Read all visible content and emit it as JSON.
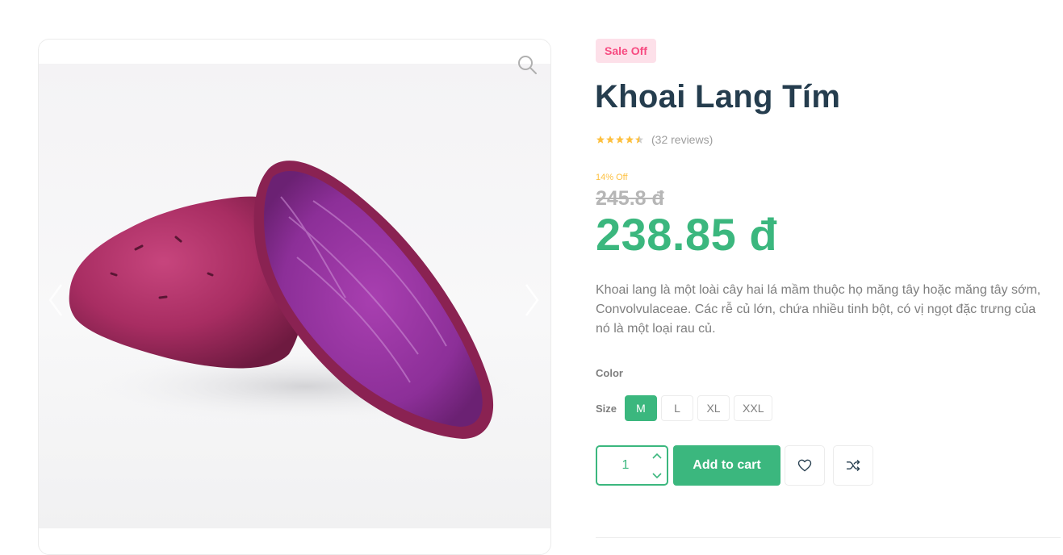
{
  "product": {
    "badge": "Sale Off",
    "title": "Khoai Lang Tím",
    "rating_value": 4.5,
    "rating_max": 5,
    "reviews": "(32 reviews)",
    "discount_label": "14% Off",
    "old_price": "245.8 đ",
    "price": "238.85 đ",
    "description": "Khoai lang là một loài cây hai lá mầm thuộc họ măng tây hoặc măng tây sớm, Convolvulaceae. Các rễ củ lớn, chứa nhiều tinh bột, có vị ngọt đặc trưng của nó là một loại rau củ."
  },
  "options": {
    "color_label": "Color",
    "size_label": "Size",
    "sizes": [
      "M",
      "L",
      "XL",
      "XXL"
    ],
    "selected_size": "M"
  },
  "cart": {
    "quantity": "1",
    "add_label": "Add to cart"
  },
  "gallery": {
    "icons": [
      "zoom-icon",
      "chevron-left-icon",
      "chevron-right-icon"
    ]
  },
  "colors": {
    "accent": "#3bb77e",
    "badge_bg": "#fde0e9",
    "badge_text": "#f74b81",
    "star": "#fdc040",
    "title": "#253d4e",
    "muted": "#7e7e7e"
  }
}
